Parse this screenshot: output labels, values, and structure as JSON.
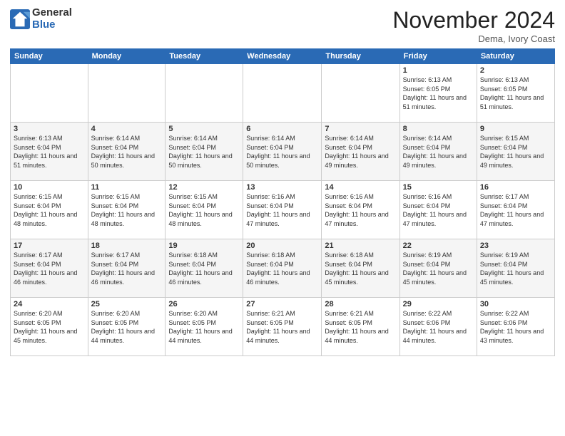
{
  "logo": {
    "general": "General",
    "blue": "Blue"
  },
  "header": {
    "month": "November 2024",
    "location": "Dema, Ivory Coast"
  },
  "weekdays": [
    "Sunday",
    "Monday",
    "Tuesday",
    "Wednesday",
    "Thursday",
    "Friday",
    "Saturday"
  ],
  "weeks": [
    [
      {
        "num": "",
        "info": ""
      },
      {
        "num": "",
        "info": ""
      },
      {
        "num": "",
        "info": ""
      },
      {
        "num": "",
        "info": ""
      },
      {
        "num": "",
        "info": ""
      },
      {
        "num": "1",
        "info": "Sunrise: 6:13 AM\nSunset: 6:05 PM\nDaylight: 11 hours and 51 minutes."
      },
      {
        "num": "2",
        "info": "Sunrise: 6:13 AM\nSunset: 6:05 PM\nDaylight: 11 hours and 51 minutes."
      }
    ],
    [
      {
        "num": "3",
        "info": "Sunrise: 6:13 AM\nSunset: 6:04 PM\nDaylight: 11 hours and 51 minutes."
      },
      {
        "num": "4",
        "info": "Sunrise: 6:14 AM\nSunset: 6:04 PM\nDaylight: 11 hours and 50 minutes."
      },
      {
        "num": "5",
        "info": "Sunrise: 6:14 AM\nSunset: 6:04 PM\nDaylight: 11 hours and 50 minutes."
      },
      {
        "num": "6",
        "info": "Sunrise: 6:14 AM\nSunset: 6:04 PM\nDaylight: 11 hours and 50 minutes."
      },
      {
        "num": "7",
        "info": "Sunrise: 6:14 AM\nSunset: 6:04 PM\nDaylight: 11 hours and 49 minutes."
      },
      {
        "num": "8",
        "info": "Sunrise: 6:14 AM\nSunset: 6:04 PM\nDaylight: 11 hours and 49 minutes."
      },
      {
        "num": "9",
        "info": "Sunrise: 6:15 AM\nSunset: 6:04 PM\nDaylight: 11 hours and 49 minutes."
      }
    ],
    [
      {
        "num": "10",
        "info": "Sunrise: 6:15 AM\nSunset: 6:04 PM\nDaylight: 11 hours and 48 minutes."
      },
      {
        "num": "11",
        "info": "Sunrise: 6:15 AM\nSunset: 6:04 PM\nDaylight: 11 hours and 48 minutes."
      },
      {
        "num": "12",
        "info": "Sunrise: 6:15 AM\nSunset: 6:04 PM\nDaylight: 11 hours and 48 minutes."
      },
      {
        "num": "13",
        "info": "Sunrise: 6:16 AM\nSunset: 6:04 PM\nDaylight: 11 hours and 47 minutes."
      },
      {
        "num": "14",
        "info": "Sunrise: 6:16 AM\nSunset: 6:04 PM\nDaylight: 11 hours and 47 minutes."
      },
      {
        "num": "15",
        "info": "Sunrise: 6:16 AM\nSunset: 6:04 PM\nDaylight: 11 hours and 47 minutes."
      },
      {
        "num": "16",
        "info": "Sunrise: 6:17 AM\nSunset: 6:04 PM\nDaylight: 11 hours and 47 minutes."
      }
    ],
    [
      {
        "num": "17",
        "info": "Sunrise: 6:17 AM\nSunset: 6:04 PM\nDaylight: 11 hours and 46 minutes."
      },
      {
        "num": "18",
        "info": "Sunrise: 6:17 AM\nSunset: 6:04 PM\nDaylight: 11 hours and 46 minutes."
      },
      {
        "num": "19",
        "info": "Sunrise: 6:18 AM\nSunset: 6:04 PM\nDaylight: 11 hours and 46 minutes."
      },
      {
        "num": "20",
        "info": "Sunrise: 6:18 AM\nSunset: 6:04 PM\nDaylight: 11 hours and 46 minutes."
      },
      {
        "num": "21",
        "info": "Sunrise: 6:18 AM\nSunset: 6:04 PM\nDaylight: 11 hours and 45 minutes."
      },
      {
        "num": "22",
        "info": "Sunrise: 6:19 AM\nSunset: 6:04 PM\nDaylight: 11 hours and 45 minutes."
      },
      {
        "num": "23",
        "info": "Sunrise: 6:19 AM\nSunset: 6:04 PM\nDaylight: 11 hours and 45 minutes."
      }
    ],
    [
      {
        "num": "24",
        "info": "Sunrise: 6:20 AM\nSunset: 6:05 PM\nDaylight: 11 hours and 45 minutes."
      },
      {
        "num": "25",
        "info": "Sunrise: 6:20 AM\nSunset: 6:05 PM\nDaylight: 11 hours and 44 minutes."
      },
      {
        "num": "26",
        "info": "Sunrise: 6:20 AM\nSunset: 6:05 PM\nDaylight: 11 hours and 44 minutes."
      },
      {
        "num": "27",
        "info": "Sunrise: 6:21 AM\nSunset: 6:05 PM\nDaylight: 11 hours and 44 minutes."
      },
      {
        "num": "28",
        "info": "Sunrise: 6:21 AM\nSunset: 6:05 PM\nDaylight: 11 hours and 44 minutes."
      },
      {
        "num": "29",
        "info": "Sunrise: 6:22 AM\nSunset: 6:06 PM\nDaylight: 11 hours and 44 minutes."
      },
      {
        "num": "30",
        "info": "Sunrise: 6:22 AM\nSunset: 6:06 PM\nDaylight: 11 hours and 43 minutes."
      }
    ]
  ]
}
